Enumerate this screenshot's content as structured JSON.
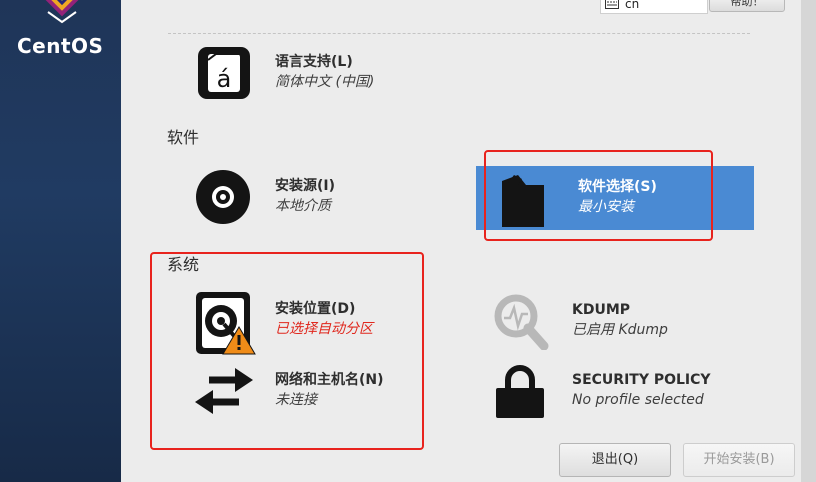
{
  "brand": {
    "name": "CentOS"
  },
  "topbar": {
    "keyboard_layout": "cn",
    "help_label": "帮助！"
  },
  "sections": {
    "software": "软件",
    "system": "系统"
  },
  "spokes": {
    "language": {
      "title": "语言支持(L)",
      "status": "简体中文 (中国)",
      "icon": "language-icon"
    },
    "install_source": {
      "title": "安装源(I)",
      "status": "本地介质",
      "icon": "disc-icon"
    },
    "software_selection": {
      "title": "软件选择(S)",
      "status": "最小安装",
      "icon": "package-icon"
    },
    "install_destination": {
      "title": "安装位置(D)",
      "status": "已选择自动分区",
      "icon": "hard-disk-warning-icon"
    },
    "kdump": {
      "title": "KDUMP",
      "status": "已启用 Kdump",
      "icon": "magnifier-icon"
    },
    "network": {
      "title": "网络和主机名(N)",
      "status": "未连接",
      "icon": "network-arrows-icon"
    },
    "security": {
      "title": "SECURITY POLICY",
      "status": "No profile selected",
      "icon": "lock-icon"
    }
  },
  "buttons": {
    "quit": "退出(Q)",
    "begin": "开始安装(B)"
  },
  "colors": {
    "sidebar": "#1f3558",
    "selected": "#4a8ad3",
    "warning": "#e0281e",
    "annotation": "#e8231d"
  }
}
